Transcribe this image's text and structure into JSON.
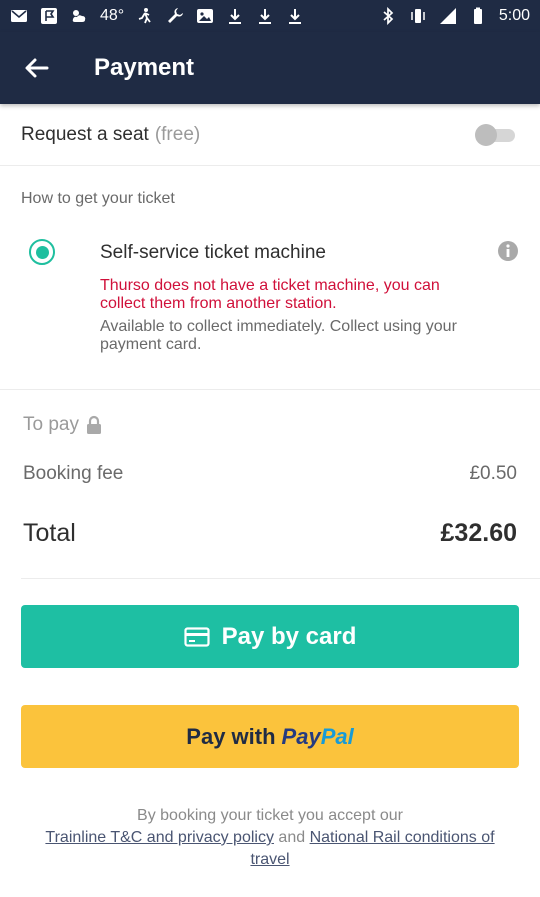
{
  "status_bar": {
    "temperature": "48°",
    "time": "5:00"
  },
  "app_bar": {
    "title": "Payment",
    "back_icon": "arrow-left-icon"
  },
  "seat_request": {
    "label": "Request a seat",
    "hint": "(free)",
    "toggle_on": false
  },
  "ticket_section": {
    "heading": "How to get your ticket",
    "option": {
      "title": "Self-service ticket machine",
      "selected": true,
      "warning": "Thurso does not have a ticket machine, you can collect them from another station.",
      "description": "Available to collect immediately. Collect using your payment card."
    }
  },
  "summary": {
    "to_pay_label": "To pay",
    "booking_fee_label": "Booking fee",
    "booking_fee_value": "£0.50",
    "total_label": "Total",
    "total_value": "£32.60"
  },
  "buttons": {
    "card_label": "Pay by card",
    "paypal_prefix": "Pay with",
    "paypal_logo_pay": "Pay",
    "paypal_logo_pal": "Pal"
  },
  "legal": {
    "prefix": "By booking your ticket you accept our",
    "tc_link": "Trainline T&C and privacy policy",
    "and": "and",
    "nr_link": "National Rail conditions of travel"
  },
  "colors": {
    "header": "#1f2b44",
    "accent": "#1ebfa3",
    "paypal_button": "#fbc33c",
    "warning": "#d0103a"
  }
}
